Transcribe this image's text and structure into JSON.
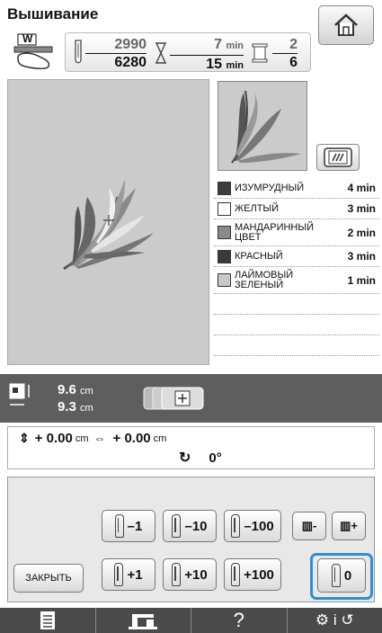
{
  "header": {
    "title": "Вышивание"
  },
  "stats": {
    "stitch_current": "2990",
    "stitch_total": "6280",
    "time_elapsed": "7",
    "time_total": "15",
    "time_unit": "min",
    "color_current": "2",
    "color_total": "6"
  },
  "presser_label": "W",
  "colors": [
    {
      "name": "ИЗУМРУДНЫЙ",
      "time": "4 min",
      "swatch": "#3c3c3c"
    },
    {
      "name": "ЖЕЛТЫЙ",
      "time": "3 min",
      "swatch": "#ffffff"
    },
    {
      "name": "МАНДАРИННЫЙ ЦВЕТ",
      "time": "2 min",
      "swatch": "#8a8a8a"
    },
    {
      "name": "КРАСНЫЙ",
      "time": "3 min",
      "swatch": "#3a3a3a"
    },
    {
      "name": "ЛАЙМОВЫЙ ЗЕЛЕНЫЙ",
      "time": "1 min",
      "swatch": "#c8c8c8"
    }
  ],
  "size": {
    "height": "9.6",
    "width": "9.3",
    "unit": "cm"
  },
  "position": {
    "y": "+ 0.00",
    "x": "+ 0.00",
    "unit": "cm",
    "rotation": "0°"
  },
  "buttons": {
    "minus1": "–1",
    "minus10": "–10",
    "minus100": "–100",
    "plus1": "+1",
    "plus10": "+10",
    "plus100": "+100",
    "close": "ЗАКРЫТЬ",
    "zero": "0"
  },
  "icons": {
    "home": "home-icon",
    "presser_foot": "presser-foot-icon",
    "needle": "needle-icon",
    "hourglass": "hourglass-icon",
    "thread_spool": "thread-spool-icon",
    "frame": "embroidery-frame-icon",
    "page": "page-icon",
    "sewing_machine": "sewing-machine-icon",
    "help": "help-icon",
    "settings": "settings-icon"
  },
  "bottom_bar": {
    "help_label": "?"
  },
  "colors_accent": {
    "highlight": "#2e8fd6",
    "panel_dark": "#5e5e5e",
    "bar_dark": "#4a4a4a"
  }
}
